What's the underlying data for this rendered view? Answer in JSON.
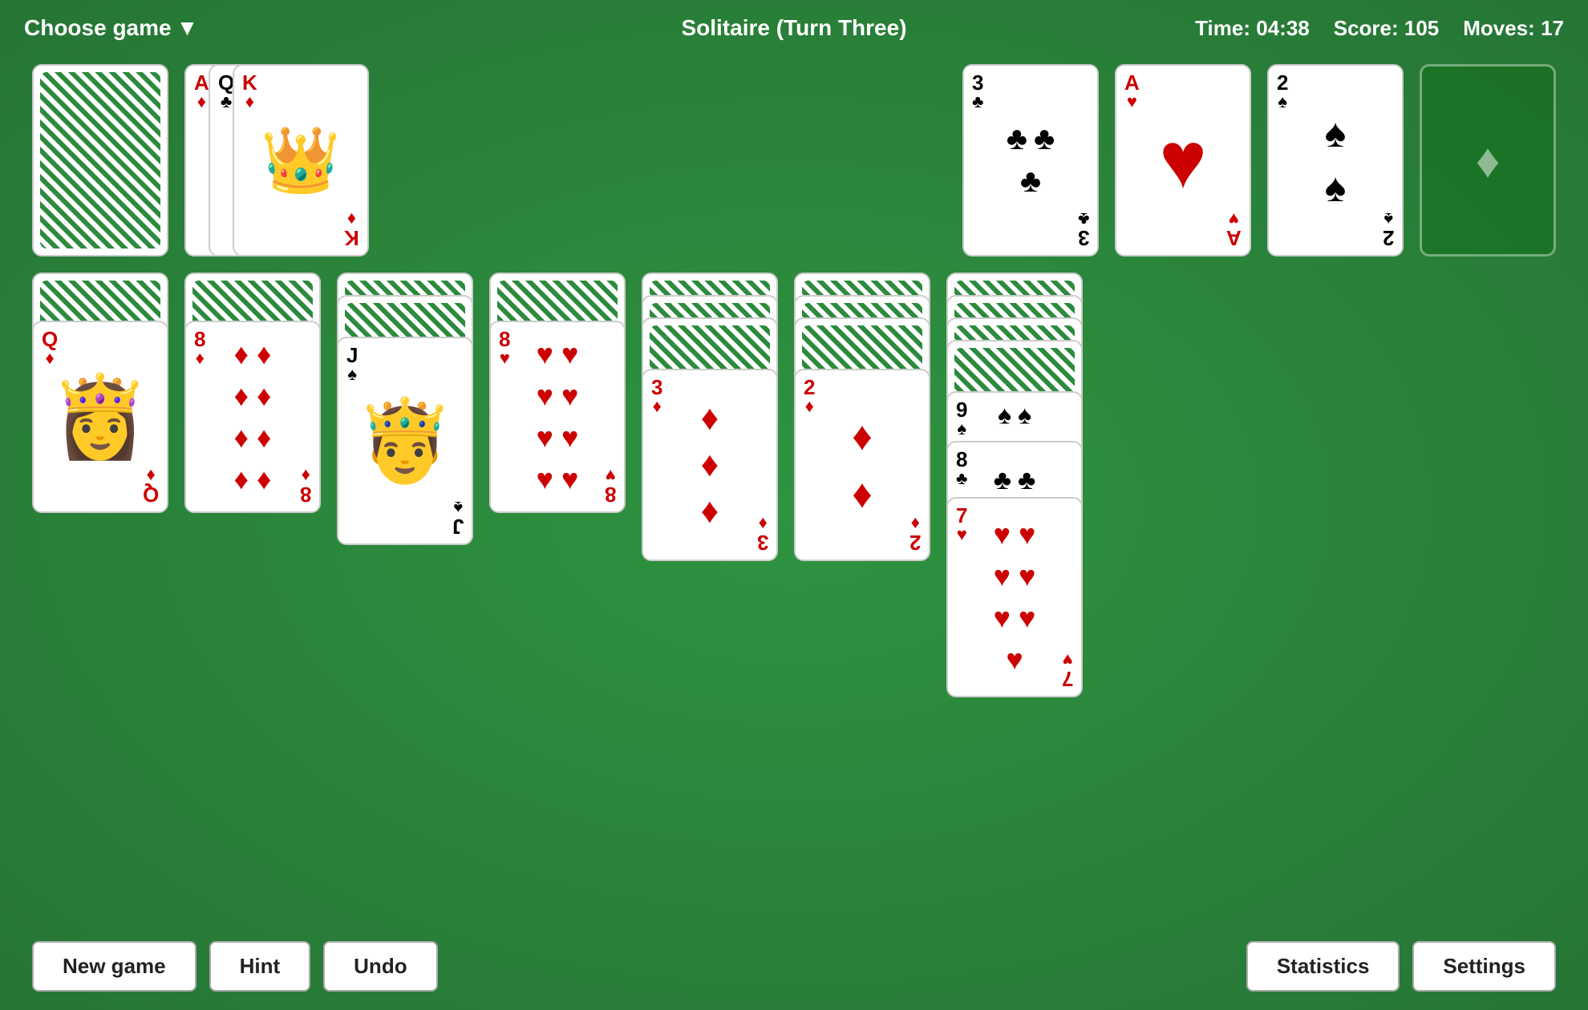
{
  "header": {
    "choose_game": "Choose game",
    "dropdown_arrow": "▼",
    "title": "Solitaire (Turn Three)",
    "time_label": "Time: 04:38",
    "score_label": "Score: 105",
    "moves_label": "Moves: 17"
  },
  "footer": {
    "new_game": "New game",
    "hint": "Hint",
    "undo": "Undo",
    "statistics": "Statistics",
    "settings": "Settings"
  },
  "foundation_diamond": "♦"
}
